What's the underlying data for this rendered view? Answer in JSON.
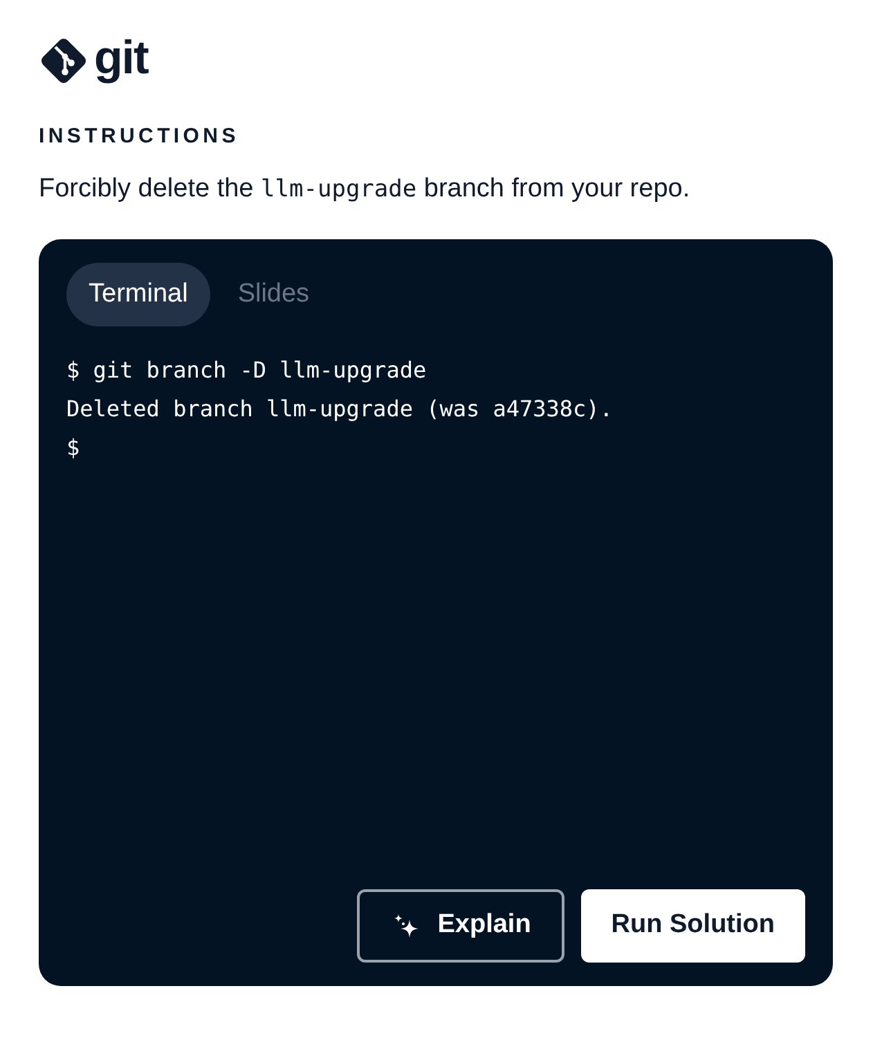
{
  "logo": {
    "text": "git"
  },
  "section_label": "INSTRUCTIONS",
  "instruction": {
    "before": "Forcibly delete the ",
    "code": "llm-upgrade",
    "after": " branch from your repo."
  },
  "tabs": [
    {
      "label": "Terminal",
      "selected": true
    },
    {
      "label": "Slides",
      "selected": false
    }
  ],
  "terminal_lines": [
    "$ git branch -D llm-upgrade",
    "Deleted branch llm-upgrade (was a47338c).",
    "$"
  ],
  "buttons": [
    {
      "label": "Explain",
      "kind": "outline"
    },
    {
      "label": "Run Solution",
      "kind": "solid"
    }
  ]
}
